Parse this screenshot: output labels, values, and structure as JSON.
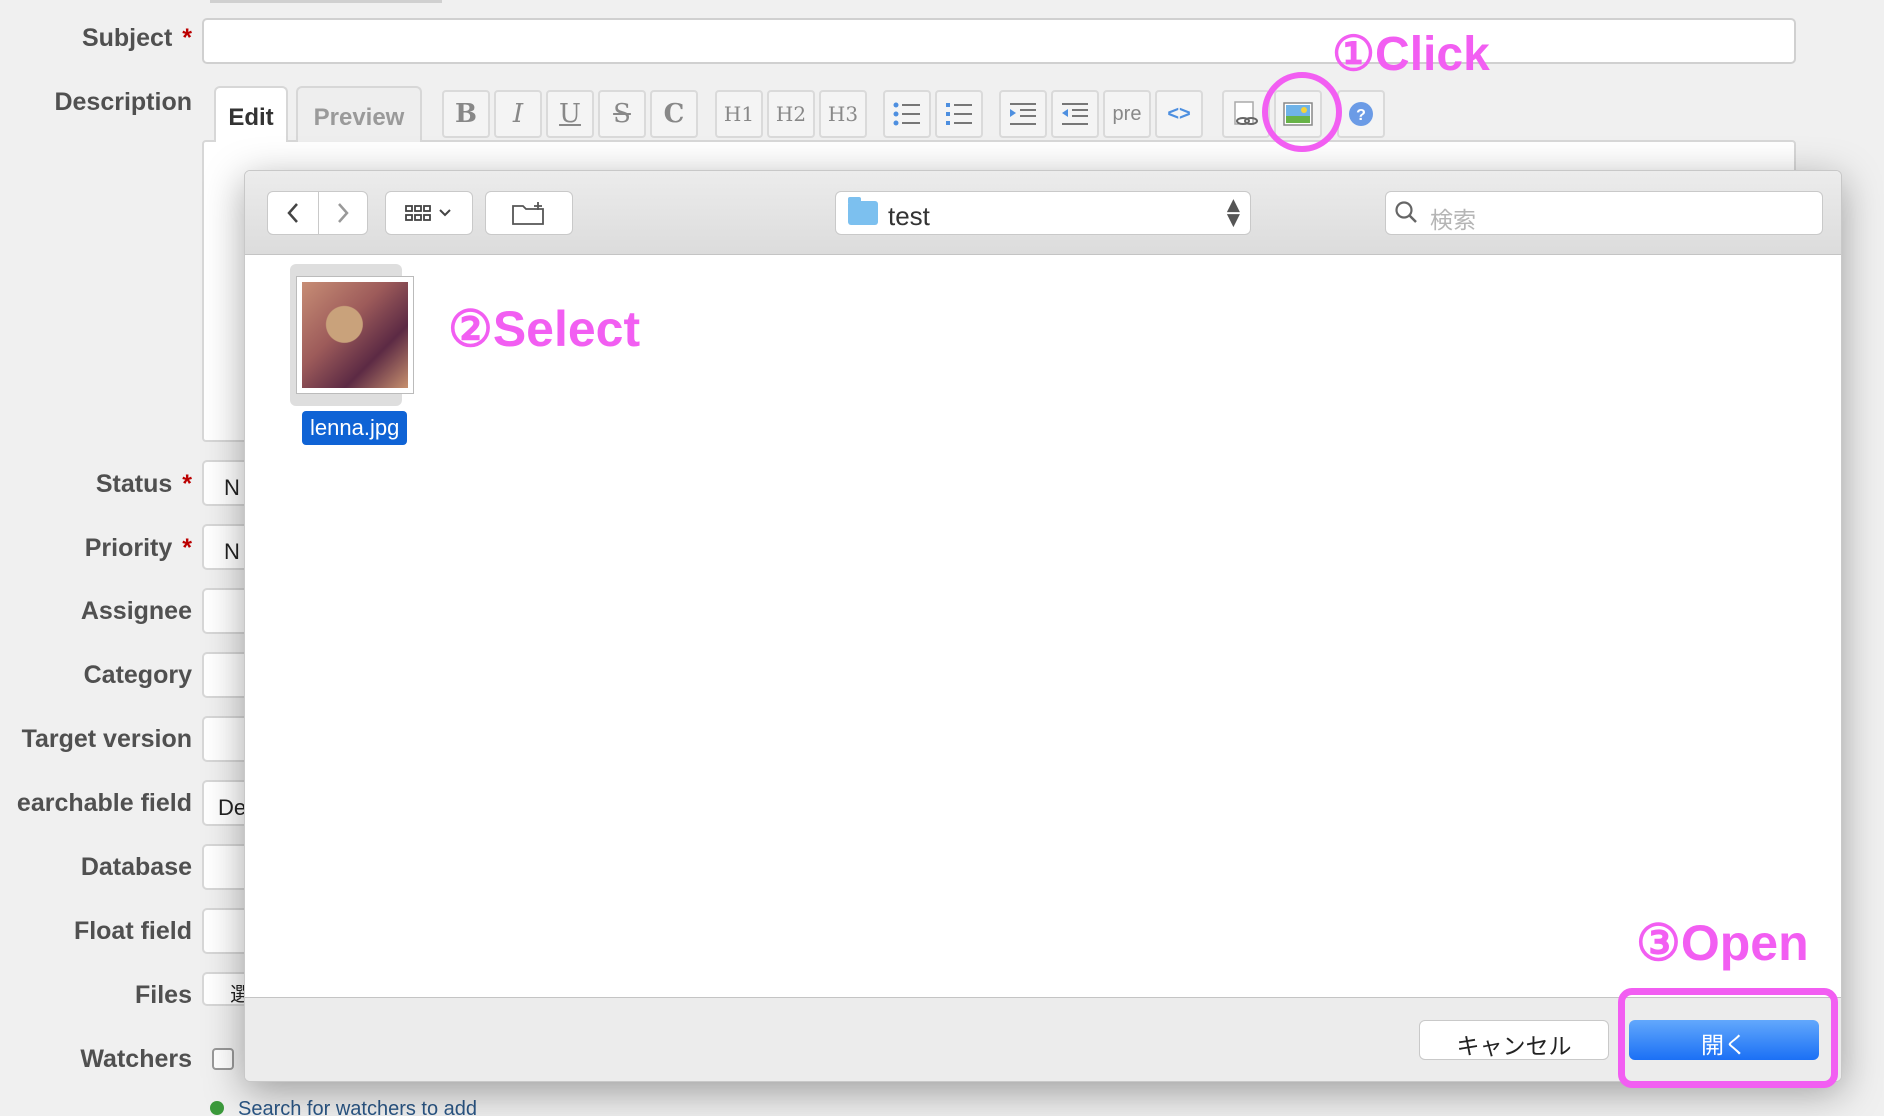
{
  "form": {
    "labels": {
      "subject": "Subject",
      "description": "Description",
      "status": "Status",
      "priority": "Priority",
      "assignee": "Assignee",
      "category": "Category",
      "target_version": "Target version",
      "searchable_field": "earchable field",
      "database": "Database",
      "float_field": "Float field",
      "files": "Files",
      "watchers": "Watchers"
    },
    "required_mark": "*",
    "values": {
      "status": "N",
      "priority": "N",
      "searchable_field": "De",
      "files": "選"
    },
    "tabs": {
      "edit": "Edit",
      "preview": "Preview"
    },
    "toolbar": {
      "bold": "B",
      "italic": "I",
      "underline": "U",
      "strike": "S",
      "code": "C",
      "h1": "H1",
      "h2": "H2",
      "h3": "H3",
      "pre": "pre",
      "inline_code": "<>"
    },
    "watchers_link": "Search for watchers to add"
  },
  "annotations": {
    "step1": "①Click",
    "step2": "②Select",
    "step3": "③Open"
  },
  "dialog": {
    "folder": "test",
    "search_placeholder": "検索",
    "file_name": "lenna.jpg",
    "cancel_label": "キャンセル",
    "open_label": "開く"
  },
  "colors": {
    "annotation": "#f25ef2",
    "open_button": "#1b70f5",
    "selection": "#0f63d5",
    "required": "#bb0000"
  }
}
